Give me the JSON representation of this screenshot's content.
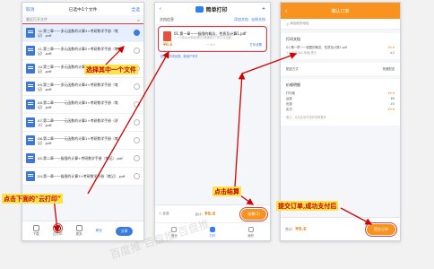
{
  "phone1": {
    "top": {
      "cancel": "取消",
      "title": "已选中1个文件",
      "select_all": "全选"
    },
    "sub_left": "最近打开文件",
    "files": [
      {
        "name": "12.第三章一一多元函数的计算3+考研数学手册（笔记）.pdf",
        "meta": "",
        "selected": true
      },
      {
        "name": "11.第三章一一多元函数的计算2+考研数学手册（笔记）.pdf",
        "meta": "",
        "selected": false
      },
      {
        "name": "10.第三章一一多元函数的计算1+考研数学手册（笔记）.pdf",
        "meta": "",
        "selected": false
      },
      {
        "name": "09.第三章一一多元函数的计算4+考研数学手册（笔记）.pdf",
        "meta": "",
        "selected": false
      },
      {
        "name": "08.第二章一一一元函数的计算3+考研数学手册（笔记）.pdf",
        "meta": "",
        "selected": false
      },
      {
        "name": "07.第二章一一一元函数的计算2+考研数学手册（讲义）.pdf",
        "meta": "",
        "selected": false
      },
      {
        "name": "06.第二章一一一元函数的计算1+考研数学手册（笔记）.pdf",
        "meta": "",
        "selected": false
      },
      {
        "name": "05.第二章一一极限的计算+考研数学手册（笔记）.pdf",
        "meta": "",
        "selected": false
      },
      {
        "name": "04.第一章一一极限的计算3+考研数学手册（笔记）.pdf",
        "meta": "",
        "selected": false
      }
    ],
    "bottom": {
      "download": "下载",
      "print": "云打印",
      "more": "更多",
      "manage": "移至",
      "share": "分享"
    }
  },
  "phone2": {
    "brand": "简单打印",
    "plus": "+",
    "head": {
      "title": "文档信息",
      "link1": "添加文档",
      "link2": "去掉文档"
    },
    "doc": {
      "title": "01.第一章一一极限的概念、性质及计算1.pdf",
      "meta": "1~10页|A4|单面|黑白|普通纸|订书钉|无边距",
      "price": "¥0.6",
      "qty": "1",
      "settings": "打印设置"
    },
    "note": "首次打印享优惠，新用户专享",
    "bar": {
      "select_all": "全选",
      "total_label": "合计：",
      "total": "¥9.6",
      "settle": "结算(1)"
    },
    "nav": [
      "首页",
      "打印",
      "我的"
    ]
  },
  "phone3": {
    "top": {
      "back": "‹",
      "title": "确认订单"
    },
    "addr": "添加收货地址",
    "doc_section": {
      "title": "打印文档",
      "name": "01.第一章一一极限的概念、性质及计算1.pdf",
      "meta": "1~10页|A4|单面|黑白",
      "price": "¥9.6",
      "qty": "×1"
    },
    "delivery": {
      "title": "配送方式",
      "value": "快递配送"
    },
    "price_section": {
      "title": "价格明细",
      "rows": [
        {
          "label": "打印费",
          "value": "¥9.6",
          "tone": "o"
        },
        {
          "label": "运费",
          "value": "¥0",
          "tone": ""
        },
        {
          "label": "优惠",
          "value": "-¥0",
          "tone": "g"
        },
        {
          "label": "实付",
          "value": "¥9.6",
          "tone": "o"
        }
      ]
    },
    "remark": "备注：请在此填写您的特殊要求",
    "bar": {
      "total_label": "合计：",
      "total": "¥9.6",
      "submit": "提交订单"
    }
  },
  "annotations": {
    "a1": "选择其中一个文件",
    "a2": "点击下面的“云打印”",
    "a3": "点击结算",
    "a4": "提交订单,成功支付后"
  },
  "watermark": "百度推 百盘推 百盘推",
  "colors": {
    "accent": "#2f7ff5",
    "orange": "#f7931e",
    "annotation_text": "#c40000",
    "annotation_bg": "#fde34a"
  }
}
